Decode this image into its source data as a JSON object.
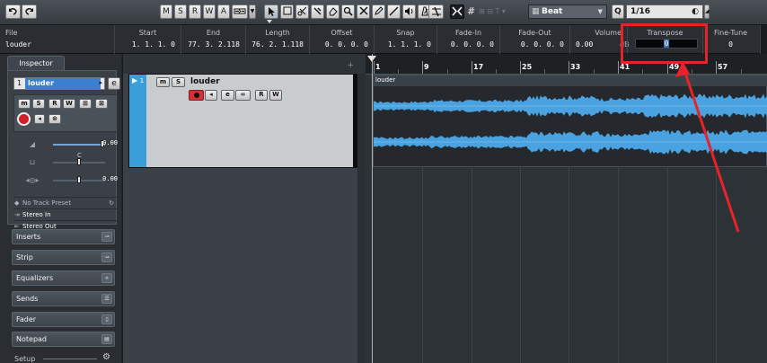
{
  "toolbar": {
    "undo": "undo",
    "redo": "redo",
    "mode_m": "M",
    "mode_s": "S",
    "mode_r": "R",
    "mode_w": "W",
    "mode_a": "A",
    "snap_type": "Beat",
    "quantize_label": "Q",
    "quantize_value": "1/16"
  },
  "infoline": {
    "columns": [
      {
        "label": "File",
        "value": "louder"
      },
      {
        "label": "Start",
        "value": "1. 1. 1.   0"
      },
      {
        "label": "End",
        "value": "77. 3. 2.118"
      },
      {
        "label": "Length",
        "value": "76. 2. 1.118"
      },
      {
        "label": "Offset",
        "value": "0. 0. 0.   0"
      },
      {
        "label": "Snap",
        "value": "1. 1. 1.   0"
      },
      {
        "label": "Fade-In",
        "value": "0. 0. 0.   0"
      },
      {
        "label": "Fade-Out",
        "value": "0. 0. 0.   0"
      },
      {
        "label": "Volume",
        "value": "0.00"
      },
      {
        "label": "Transpose",
        "value": "0"
      },
      {
        "label": "Fine-Tune",
        "value": "0"
      }
    ],
    "volume_unit": "dB"
  },
  "inspector": {
    "tab": "Inspector",
    "track_number": "1",
    "track_name": "louder",
    "volume_value": "0.00",
    "pan_value": "C",
    "delay_value": "0.00",
    "preset": "No Track Preset",
    "input": "Stereo In",
    "output": "Stereo Out",
    "sections": [
      "Inserts",
      "Strip",
      "Equalizers",
      "Sends",
      "Fader",
      "Notepad"
    ],
    "setup": "Setup"
  },
  "track": {
    "number": "1",
    "name": "louder",
    "btn_m": "m",
    "btn_s": "S",
    "btn_r": "R",
    "btn_w": "W"
  },
  "ruler": {
    "bars": [
      "1",
      "9",
      "17",
      "25",
      "33",
      "41",
      "49",
      "57"
    ]
  },
  "event": {
    "name": "louder"
  },
  "colors": {
    "track_color": "#3a9ed9",
    "waveform": "#4aa3e0",
    "annotation": "#e4232a"
  }
}
